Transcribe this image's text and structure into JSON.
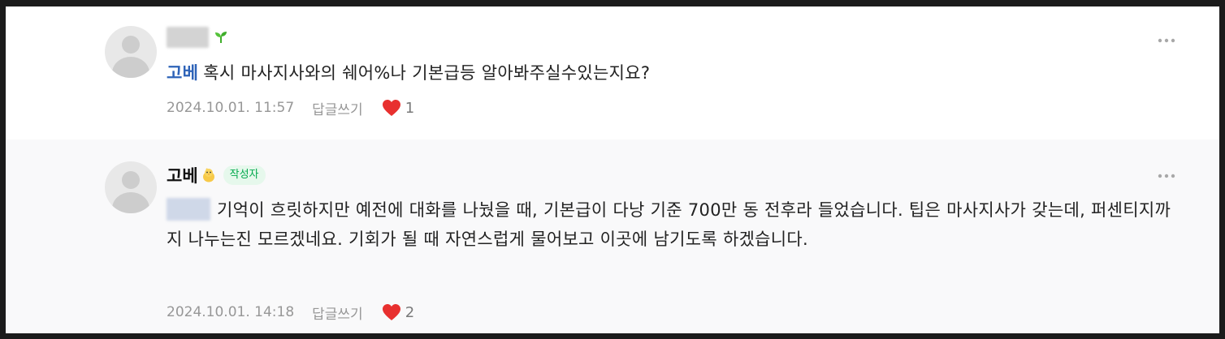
{
  "comments": [
    {
      "author": "",
      "badge_icon": "sprout-icon",
      "mention": "고베",
      "text": "혹시 마사지사와의 쉐어%나 기본급등 알아봐주실수있는지요?",
      "date": "2024.10.01. 11:57",
      "reply_label": "답글쓰기",
      "likes": "1"
    },
    {
      "author": "고베",
      "badge_icon": "chick-icon",
      "author_badge": "작성자",
      "mention": "",
      "text": "기억이 흐릿하지만 예전에 대화를 나눴을 때, 기본급이 다낭 기준 700만 동 전후라 들었습니다. 팁은 마사지사가 갖는데, 퍼센티지까지 나누는진 모르겠네요. 기회가 될 때 자연스럽게 물어보고 이곳에 남기도록 하겠습니다.",
      "date": "2024.10.01. 14:18",
      "reply_label": "답글쓰기",
      "likes": "2"
    }
  ],
  "colors": {
    "mention": "#2e63b8",
    "heart": "#e8302f",
    "badge_bg": "#e6f8ec",
    "badge_text": "#03a94d"
  }
}
